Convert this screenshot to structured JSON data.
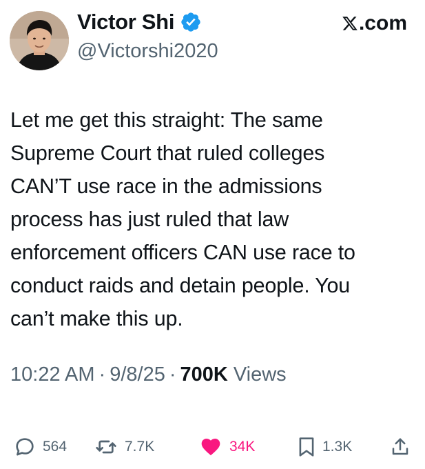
{
  "author": {
    "display_name": "Victor Shi",
    "handle": "@Victorshi2020",
    "verified": true,
    "verified_color": "#1d9bf0"
  },
  "source": {
    "label": ".com",
    "icon": "x-logo-icon"
  },
  "tweet": {
    "text": "Let me get this straight: The same\nSupreme Court that ruled colleges\nCAN’T use race in the admissions\nprocess has just ruled that law\nenforcement officers CAN use race to\nconduct raids and detain people. You\ncan’t make this up."
  },
  "meta": {
    "time": "10:22 AM",
    "date": "9/8/25",
    "separator": "·",
    "views_count": "700K",
    "views_label": "Views"
  },
  "actions": {
    "replies": "564",
    "reposts": "7.7K",
    "likes": "34K",
    "bookmarks": "1.3K",
    "like_color": "#f91880"
  }
}
